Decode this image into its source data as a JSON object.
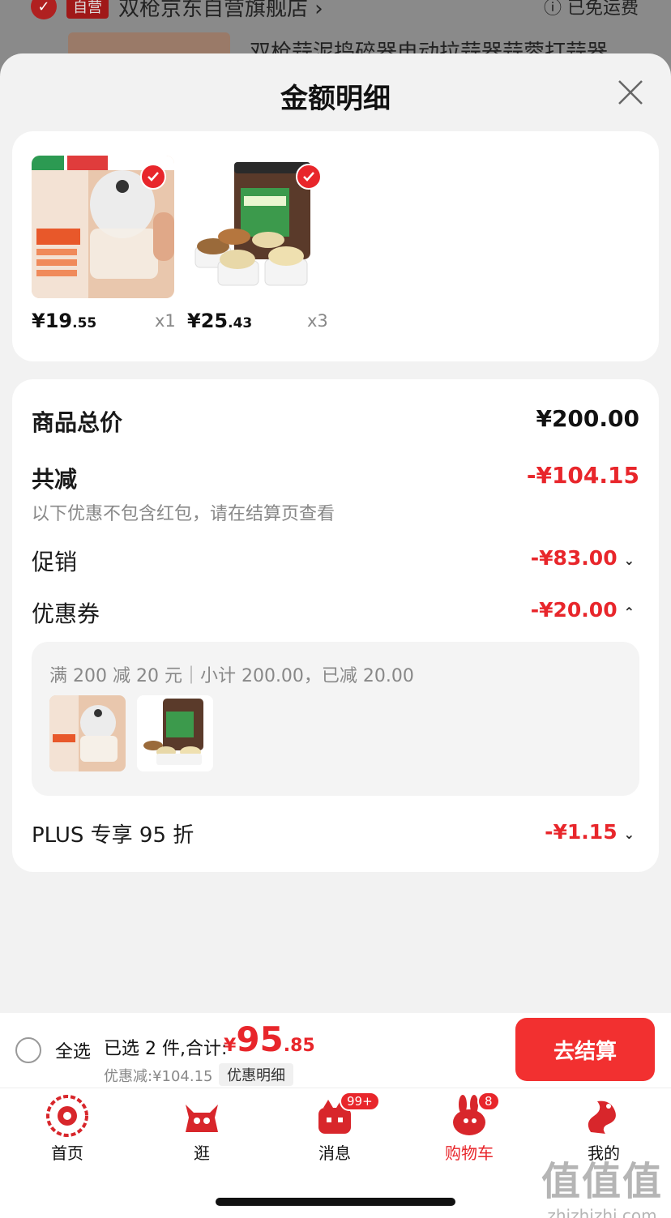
{
  "background": {
    "store_tag": "自营",
    "store_name": "双枪京东自营旗舰店 ›",
    "free_shipping": "ⓘ 已免运费",
    "product_title": "双枪蒜泥捣碎器电动拉蒜器蒜蓉打蒜器"
  },
  "sheet": {
    "title": "金额明细"
  },
  "products": [
    {
      "name": "garlic-chopper",
      "price_int": "¥19",
      "price_dec": ".55",
      "qty": "x1"
    },
    {
      "name": "mixed-nuts",
      "price_int": "¥25",
      "price_dec": ".43",
      "qty": "x3"
    }
  ],
  "detail": {
    "total_label": "商品总价",
    "total_value": "¥200.00",
    "reduce_label": "共减",
    "reduce_value": "-¥104.15",
    "reduce_note": "以下优惠不包含红包，请在结算页查看",
    "promo_label": "促销",
    "promo_value": "-¥83.00",
    "coupon_label": "优惠券",
    "coupon_value": "-¥20.00",
    "coupon_desc": "满 200 减 20 元｜小计 200.00，已减 20.00",
    "plus_label": "PLUS 专享 95 折",
    "plus_value": "-¥1.15"
  },
  "checkout": {
    "select_all": "全选",
    "selected": "已选 2 件,合计:",
    "total_sym": "¥",
    "total_int": "95",
    "total_dec": ".85",
    "discount": "优惠减:¥104.15",
    "detail_link": "优惠明细",
    "button": "去结算"
  },
  "tabs": [
    {
      "label": "首页",
      "badge": ""
    },
    {
      "label": "逛",
      "badge": ""
    },
    {
      "label": "消息",
      "badge": "99+"
    },
    {
      "label": "购物车",
      "badge": "8"
    },
    {
      "label": "我的",
      "badge": ""
    }
  ],
  "watermark": {
    "logo": "值值值",
    "url": "zhizhizhi.com"
  },
  "colors": {
    "accent_red": "#e8262b",
    "button_red": "#f23030"
  }
}
